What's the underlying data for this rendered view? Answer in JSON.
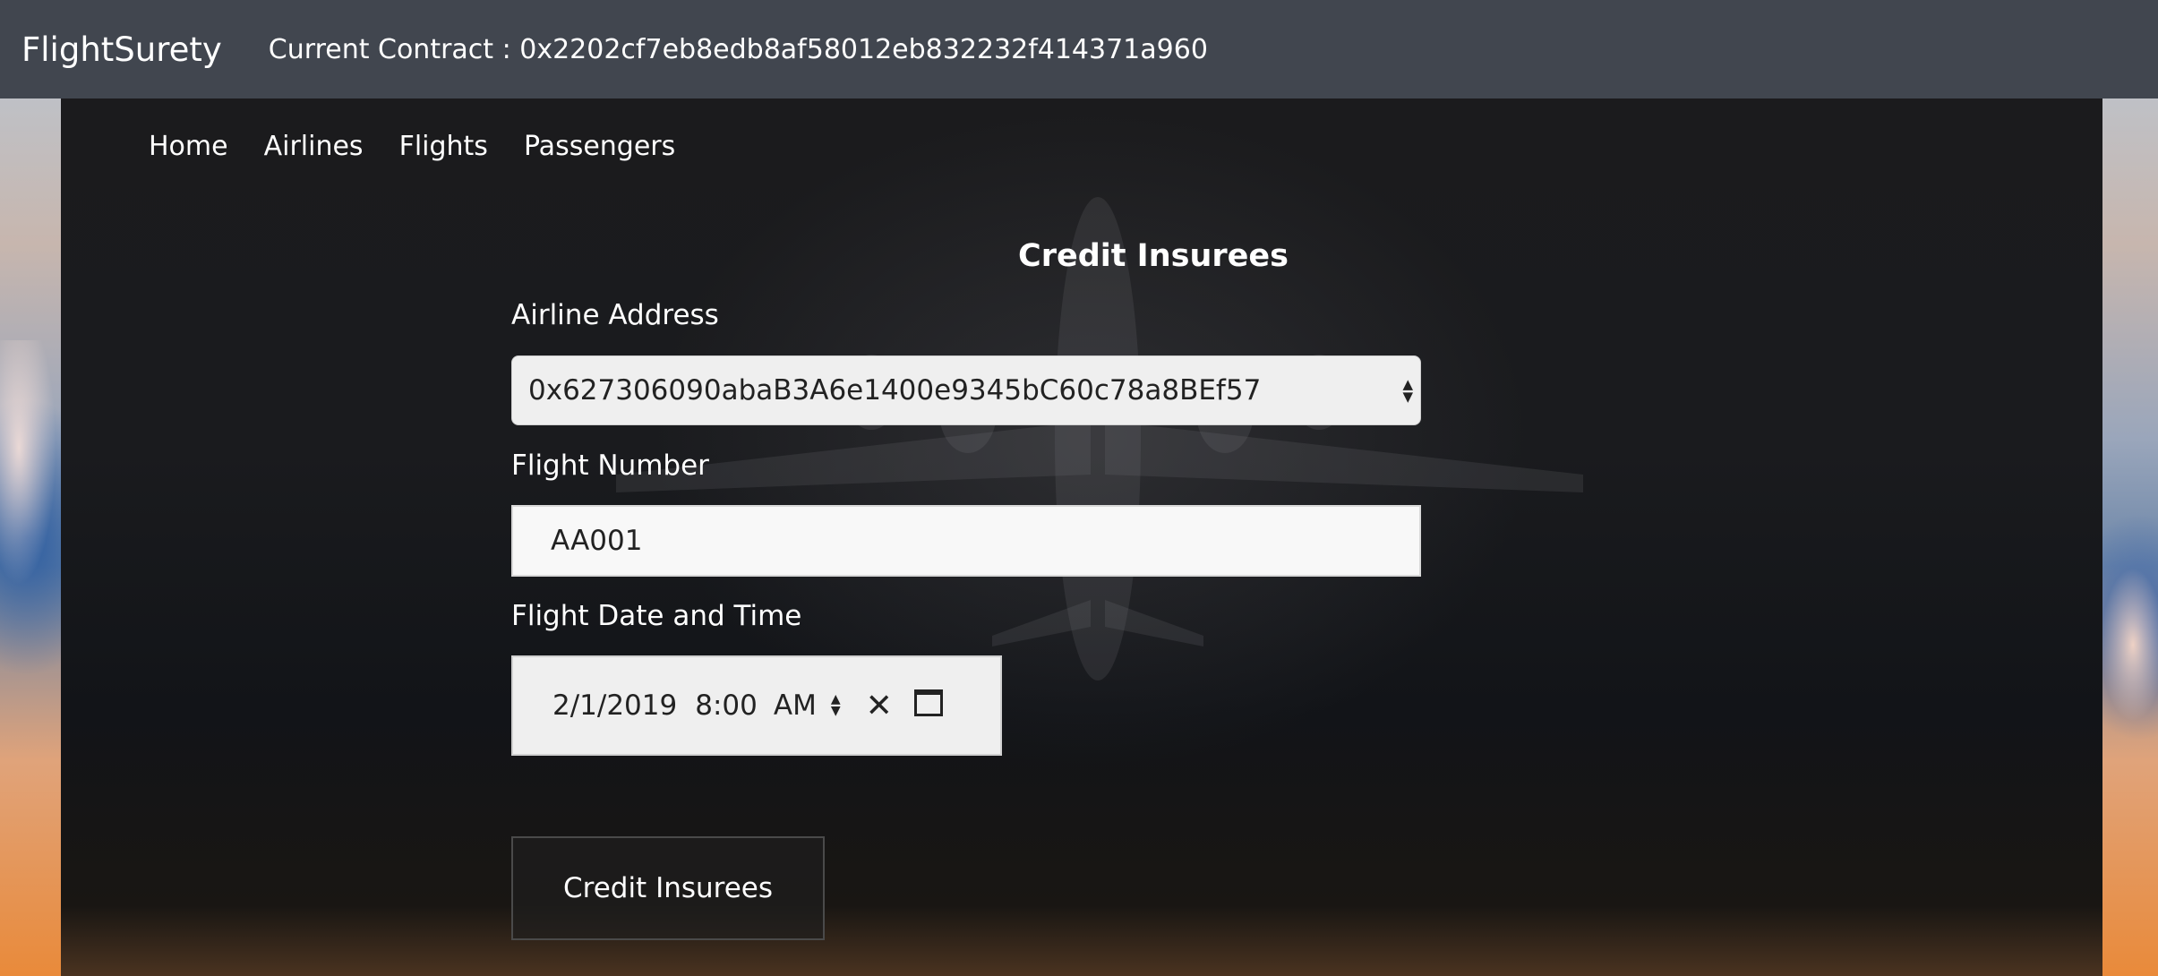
{
  "navbar": {
    "brand": "FlightSurety",
    "contract_label": "Current Contract : 0x2202cf7eb8edb8af58012eb832232f414371a960"
  },
  "tabs": [
    {
      "label": "Home"
    },
    {
      "label": "Airlines"
    },
    {
      "label": "Flights"
    },
    {
      "label": "Passengers"
    }
  ],
  "form": {
    "title": "Credit Insurees",
    "airline_label": "Airline Address",
    "airline_selected": "0x627306090abaB3A6e1400e9345bC60c78a8BEf57",
    "flight_number_label": "Flight Number",
    "flight_number_value": "AA001",
    "datetime_label": "Flight Date and Time",
    "date_value": "2/1/2019",
    "time_value": "8:00",
    "ampm_value": "AM",
    "submit_label": "Credit Insurees"
  }
}
